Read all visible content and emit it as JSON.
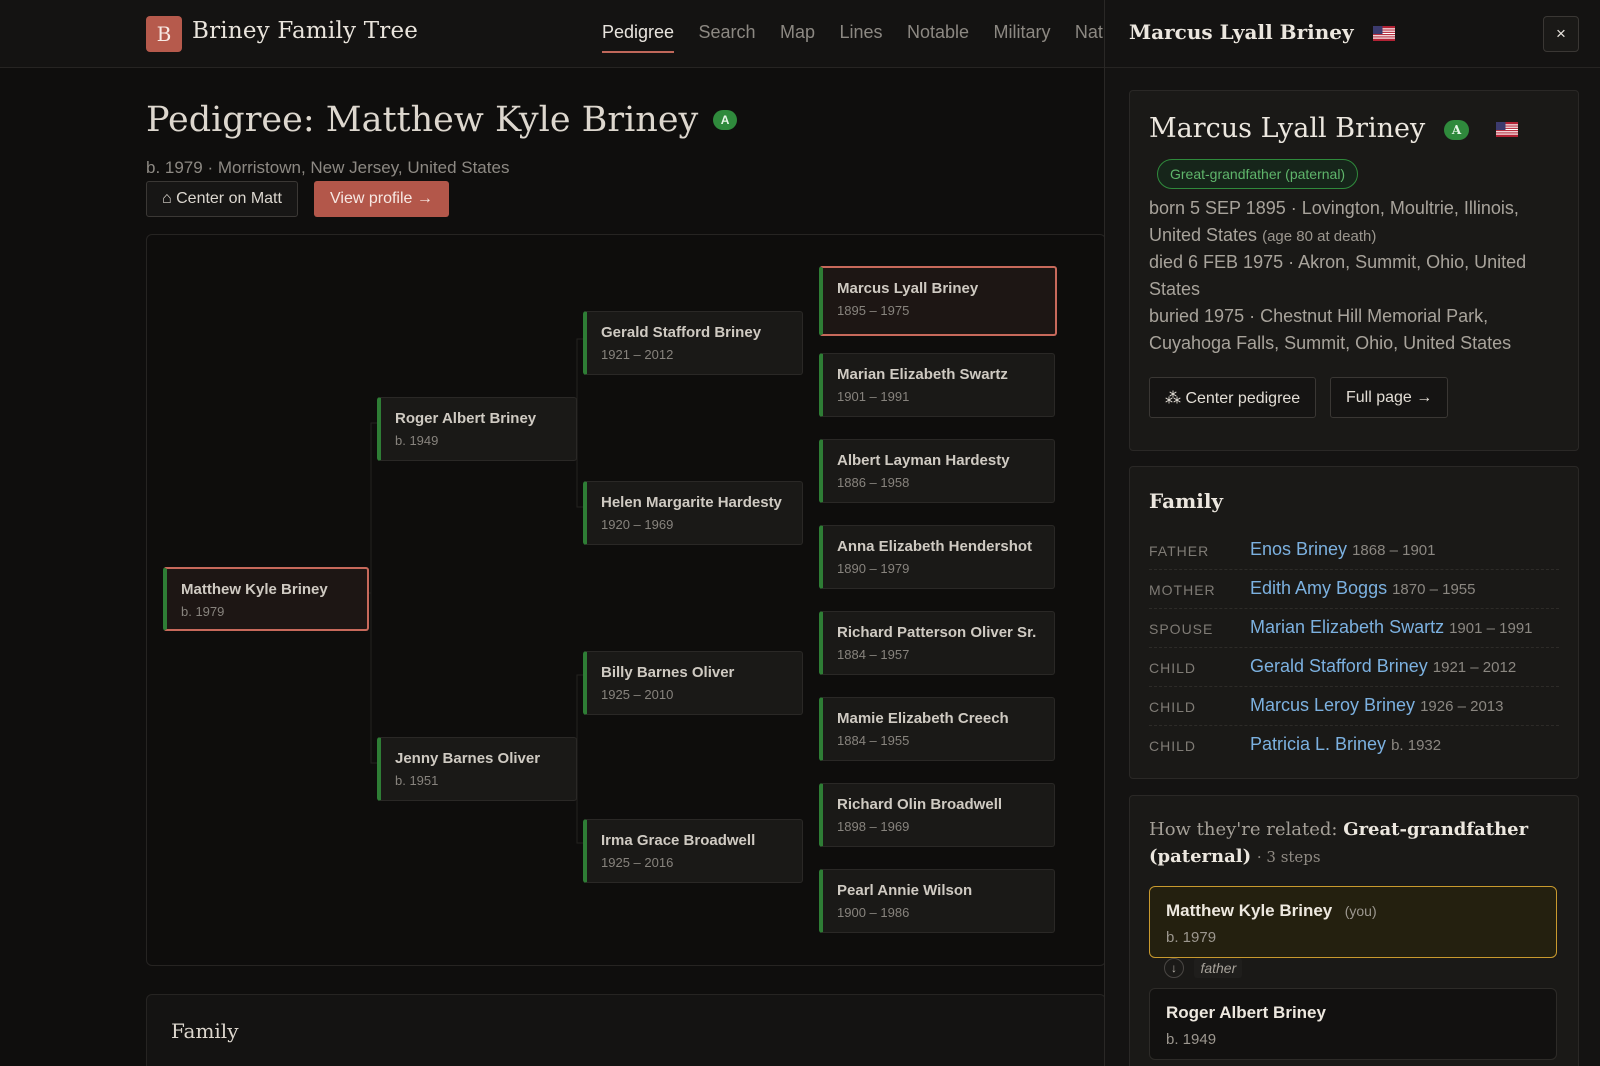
{
  "app": {
    "logo_letter": "B",
    "title": "Briney Family Tree"
  },
  "nav": [
    {
      "label": "Pedigree",
      "active": true
    },
    {
      "label": "Search"
    },
    {
      "label": "Map"
    },
    {
      "label": "Lines"
    },
    {
      "label": "Notable"
    },
    {
      "label": "Military"
    },
    {
      "label": "Nat"
    }
  ],
  "page": {
    "title": "Pedigree: Matthew Kyle Briney",
    "badge": "A",
    "meta": "b. 1979 · Morristown, New Jersey, United States",
    "center_button": "⌂ Center on Matt",
    "view_profile_button": "View profile →"
  },
  "pedigree": {
    "subject": {
      "name": "Matthew Kyle Briney",
      "dates": "b. 1979"
    },
    "parents": [
      {
        "name": "Roger Albert Briney",
        "dates": "b. 1949"
      },
      {
        "name": "Jenny Barnes Oliver",
        "dates": "b. 1951"
      }
    ],
    "grandparents": [
      {
        "name": "Gerald Stafford Briney",
        "dates": "1921 – 2012"
      },
      {
        "name": "Helen Margarite Hardesty",
        "dates": "1920 – 1969"
      },
      {
        "name": "Billy Barnes Oliver",
        "dates": "1925 – 2010"
      },
      {
        "name": "Irma Grace Broadwell",
        "dates": "1925 – 2016"
      }
    ],
    "great_grandparents": [
      {
        "name": "Marcus Lyall Briney",
        "dates": "1895 – 1975",
        "selected": true
      },
      {
        "name": "Marian Elizabeth Swartz",
        "dates": "1901 – 1991"
      },
      {
        "name": "Albert Layman Hardesty",
        "dates": "1886 – 1958"
      },
      {
        "name": "Anna Elizabeth Hendershot",
        "dates": "1890 – 1979"
      },
      {
        "name": "Richard Patterson Oliver Sr.",
        "dates": "1884 – 1957"
      },
      {
        "name": "Mamie Elizabeth Creech",
        "dates": "1884 – 1955"
      },
      {
        "name": "Richard Olin Broadwell",
        "dates": "1898 – 1969"
      },
      {
        "name": "Pearl Annie Wilson",
        "dates": "1900 – 1986"
      }
    ]
  },
  "family_section_title": "Family",
  "drawer": {
    "title": "Marcus Lyall Briney",
    "flag_icon": "us-flag-icon",
    "close_label": "×",
    "profile": {
      "name": "Marcus Lyall Briney",
      "badge": "A",
      "relation": "Great-grandfather (paternal)",
      "born": "born 5 SEP 1895 · Lovington, Moultrie, Illinois, United States",
      "age_at_death": "(age 80 at death)",
      "died": "died 6 FEB 1975 · Akron, Summit, Ohio, United States",
      "buried": "buried 1975 · Chestnut Hill Memorial Park, Cuyahoga Falls, Summit, Ohio, United States",
      "center_button": "⁂ Center pedigree",
      "full_page_button": "Full page →"
    },
    "family": {
      "title": "Family",
      "rows": [
        {
          "role": "Father",
          "name": "Enos Briney",
          "dates": "1868 – 1901"
        },
        {
          "role": "Mother",
          "name": "Edith Amy Boggs",
          "dates": "1870 – 1955"
        },
        {
          "role": "Spouse",
          "name": "Marian Elizabeth Swartz",
          "dates": "1901 – 1991"
        },
        {
          "role": "Child",
          "name": "Gerald Stafford Briney",
          "dates": "1921 – 2012"
        },
        {
          "role": "Child",
          "name": "Marcus Leroy Briney",
          "dates": "1926 – 2013"
        },
        {
          "role": "Child",
          "name": "Patricia L. Briney",
          "dates": "b. 1932"
        }
      ]
    },
    "related": {
      "prefix": "How they're related:",
      "relation": "Great-grandfather (paternal)",
      "steps": "· 3 steps",
      "chain": [
        {
          "name": "Matthew Kyle Briney",
          "you": "(you)",
          "dates": "b. 1979"
        },
        {
          "name": "Roger Albert Briney",
          "dates": "b. 1949"
        }
      ],
      "step_label": "father",
      "step_icon": "arrow-down-icon"
    }
  },
  "colors": {
    "accent": "#b3574a",
    "living_marker": "#2e7d35",
    "link": "#7cb1e0",
    "highlight": "#c99a2e"
  }
}
